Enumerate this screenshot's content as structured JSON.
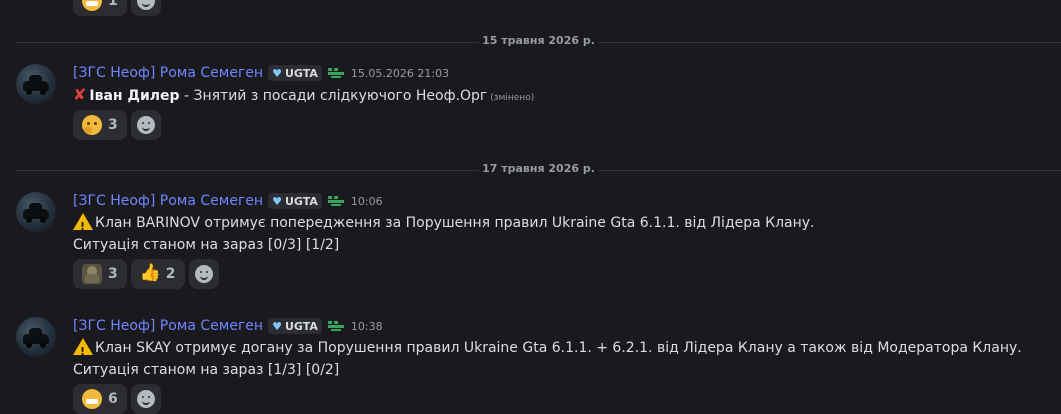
{
  "top_reactions": [
    {
      "emoji": "laughing-emoji",
      "count": "1"
    },
    {
      "emoji": "add-reaction-icon",
      "count": ""
    }
  ],
  "dividers": [
    {
      "label": "15 травня 2026 р."
    },
    {
      "label": "17 травня 2026 р."
    }
  ],
  "messages": [
    {
      "username": "[ЗГС Неоф] Рома Семеген",
      "tag": "UGTA",
      "timestamp": "15.05.2026 21:03",
      "line1_prefix": "✘",
      "line1_bold": "Іван Дилер",
      "line1_text": " - Знятий з посади слідкуючого Неоф.Орг",
      "edited": "(змінено)",
      "reactions": [
        {
          "emoji": "thinking-face-emoji",
          "count": "3"
        }
      ]
    },
    {
      "username": "[ЗГС Неоф] Рома Семеген",
      "tag": "UGTA",
      "timestamp": "10:06",
      "line1_text": "Клан BARINOV отримує попередження за Порушення правил Ukraine Gta 6.1.1. від Лідера  Клану.",
      "line2_text": "Ситуація станом на зараз [0/3] [1/2]",
      "reactions": [
        {
          "emoji": "soldier-emoji",
          "count": "3"
        },
        {
          "emoji": "thumbs-up-emoji",
          "count": "2"
        }
      ]
    },
    {
      "username": "[ЗГС Неоф] Рома Семеген",
      "tag": "UGTA",
      "timestamp": "10:38",
      "line1_text": "Клан SKAY отримує догану за Порушення правил Ukraine Gta 6.1.1.  + 6.2.1. від Лідера Клану а також від Модератора Клану.",
      "line2_text": "Ситуація станом на зараз [1/3] [0/2]",
      "reactions": [
        {
          "emoji": "grinning-emoji",
          "count": "6"
        }
      ]
    }
  ]
}
